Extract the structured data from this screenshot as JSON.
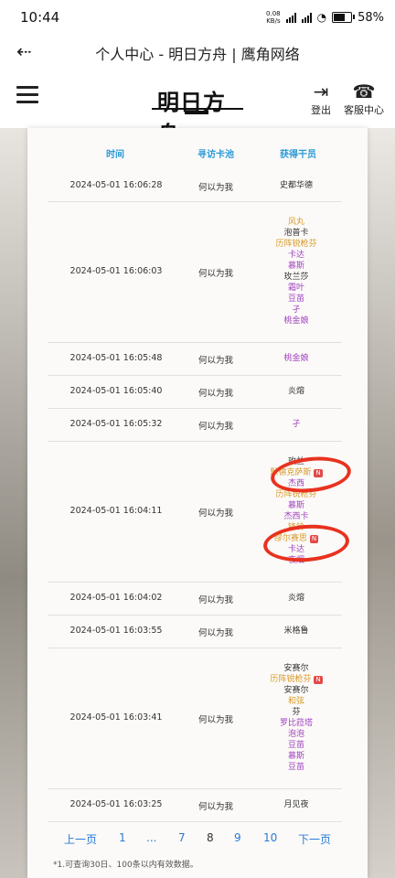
{
  "status": {
    "time": "10:44",
    "speed_top": "0.08",
    "speed_unit": "KB/s",
    "battery": "58%"
  },
  "browser": {
    "title": "个人中心 - 明日方舟 | 鹰角网络"
  },
  "header": {
    "logo": "明日方舟",
    "logout": "登出",
    "support": "客服中心"
  },
  "table": {
    "headers": [
      "时间",
      "寻访卡池",
      "获得干员"
    ],
    "rows": [
      {
        "time": "2024-05-01 16:06:28",
        "pool": "何以为我",
        "ops": [
          {
            "n": "史都华德",
            "c": "#333"
          }
        ]
      },
      {
        "time": "2024-05-01 16:06:03",
        "pool": "何以为我",
        "ops": [
          {
            "n": "风丸",
            "c": "#d89a2a"
          },
          {
            "n": "泡普卡",
            "c": "#333"
          },
          {
            "n": "历阵锐枪芬",
            "c": "#d89a2a"
          },
          {
            "n": "卡达",
            "c": "#a040c0"
          },
          {
            "n": "慕斯",
            "c": "#a040c0"
          },
          {
            "n": "玫兰莎",
            "c": "#333"
          },
          {
            "n": "霜叶",
            "c": "#a040c0"
          },
          {
            "n": "豆苗",
            "c": "#a040c0"
          },
          {
            "n": "孑",
            "c": "#a040c0"
          },
          {
            "n": "桃金娘",
            "c": "#a040c0"
          }
        ]
      },
      {
        "time": "2024-05-01 16:05:48",
        "pool": "何以为我",
        "ops": [
          {
            "n": "桃金娘",
            "c": "#a040c0"
          }
        ]
      },
      {
        "time": "2024-05-01 16:05:40",
        "pool": "何以为我",
        "ops": [
          {
            "n": "炎熔",
            "c": "#333"
          }
        ]
      },
      {
        "time": "2024-05-01 16:05:32",
        "pool": "何以为我",
        "ops": [
          {
            "n": "孑",
            "c": "#a040c0"
          }
        ]
      },
      {
        "time": "2024-05-01 16:04:11",
        "pool": "何以为我",
        "ops": [
          {
            "n": "玫兰",
            "c": "#333"
          },
          {
            "n": "默德克萨斯",
            "c": "#d89a2a",
            "new": "N"
          },
          {
            "n": "杰西",
            "c": "#a040c0"
          },
          {
            "n": "历阵锐枪芬",
            "c": "#d89a2a"
          },
          {
            "n": "慕斯",
            "c": "#a040c0"
          },
          {
            "n": "杰西卡",
            "c": "#a040c0"
          },
          {
            "n": "锋铃",
            "c": "#d89a2a"
          },
          {
            "n": "缪尔赛思",
            "c": "#d89a2a",
            "new": "N"
          },
          {
            "n": "卡达",
            "c": "#a040c0"
          },
          {
            "n": "夜烟",
            "c": "#a040c0"
          }
        ]
      },
      {
        "time": "2024-05-01 16:04:02",
        "pool": "何以为我",
        "ops": [
          {
            "n": "炎熔",
            "c": "#333"
          }
        ]
      },
      {
        "time": "2024-05-01 16:03:55",
        "pool": "何以为我",
        "ops": [
          {
            "n": "米格鲁",
            "c": "#333"
          }
        ]
      },
      {
        "time": "2024-05-01 16:03:41",
        "pool": "何以为我",
        "ops": [
          {
            "n": "安赛尔",
            "c": "#333"
          },
          {
            "n": "历阵锐枪芬",
            "c": "#d89a2a",
            "new": "N"
          },
          {
            "n": "安赛尔",
            "c": "#333"
          },
          {
            "n": "和弦",
            "c": "#d89a2a"
          },
          {
            "n": "芬",
            "c": "#333"
          },
          {
            "n": "罗比菈塔",
            "c": "#a040c0"
          },
          {
            "n": "泡泡",
            "c": "#a040c0"
          },
          {
            "n": "豆苗",
            "c": "#a040c0"
          },
          {
            "n": "慕斯",
            "c": "#a040c0"
          },
          {
            "n": "豆苗",
            "c": "#a040c0"
          }
        ]
      },
      {
        "time": "2024-05-01 16:03:25",
        "pool": "何以为我",
        "ops": [
          {
            "n": "月见夜",
            "c": "#333"
          }
        ]
      }
    ]
  },
  "pager": {
    "prev": "上一页",
    "p1": "1",
    "dots": "...",
    "p7": "7",
    "p8": "8",
    "p9": "9",
    "p10": "10",
    "next": "下一页"
  },
  "note": "*1.可查询30日、100条以内有效数据。"
}
